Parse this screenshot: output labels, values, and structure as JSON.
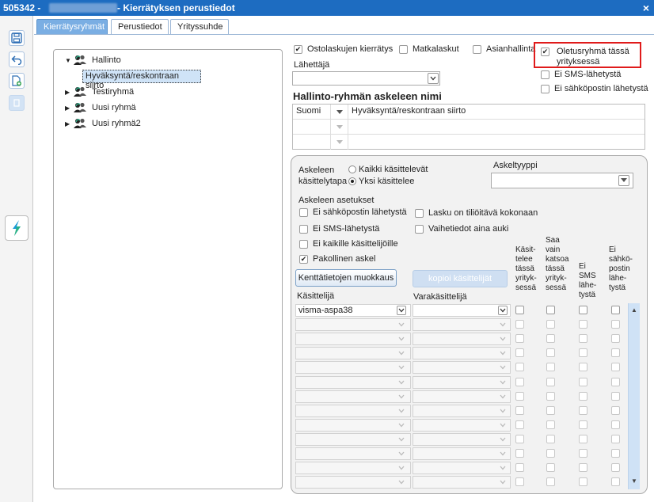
{
  "window": {
    "title_prefix": "505342 -",
    "title_suffix": "- Kierrätyksen perustiedot",
    "close_glyph": "×"
  },
  "toolbar": {
    "icons": [
      "save-icon",
      "back-icon",
      "new-document-icon",
      "disabled-action-icon",
      "app-logo-icon"
    ]
  },
  "tabs": [
    {
      "label": "Kierrätysryhmät",
      "active": true
    },
    {
      "label": "Perustiedot",
      "active": false
    },
    {
      "label": "Yrityssuhde",
      "active": false
    }
  ],
  "tree": {
    "nodes": [
      {
        "label": "Hallinto",
        "expanded": true
      },
      {
        "label": "Hyväksyntä/reskontraan siirto",
        "selected": true
      },
      {
        "label": "Testiryhmä",
        "expanded": false
      },
      {
        "label": "Uusi ryhmä",
        "expanded": false
      },
      {
        "label": "Uusi ryhmä2",
        "expanded": false
      }
    ]
  },
  "options": {
    "ostolaskujen": {
      "label": "Ostolaskujen kierrätys",
      "checked": true
    },
    "matkalaskut": {
      "label": "Matkalaskut",
      "checked": false
    },
    "asianhallinta": {
      "label": "Asianhallinta",
      "checked": false
    },
    "oletusryhma": {
      "label_line1": "Oletusryhmä tässä",
      "label_line2": "yrityksessä",
      "checked": true
    },
    "ei_sms": {
      "label": "Ei SMS-lähetystä",
      "checked": false
    },
    "ei_sahkoposti": {
      "label": "Ei sähköpostin lähetystä",
      "checked": false
    }
  },
  "sender": {
    "label": "Lähettäjä",
    "value": ""
  },
  "step_name": {
    "heading": "Hallinto-ryhmän askeleen nimi",
    "rows": [
      {
        "language": "Suomi",
        "name": "Hyväksyntä/reskontraan siirto"
      },
      {
        "language": "",
        "name": ""
      },
      {
        "language": "",
        "name": ""
      }
    ]
  },
  "step_panel": {
    "handling_label_line1": "Askeleen",
    "handling_label_line2": "käsittelytapa",
    "radio_all": {
      "label": "Kaikki käsittelevät",
      "selected": false
    },
    "radio_one": {
      "label": "Yksi käsittelee",
      "selected": true
    },
    "step_type_label": "Askeltyyppi",
    "step_type_value": "",
    "settings_heading": "Askeleen asetukset",
    "settings": {
      "ei_sahkoposti": {
        "label": "Ei sähköpostin lähetystä",
        "checked": false
      },
      "lasku_tiliointi": {
        "label": "Lasku on tiliöitävä kokonaan",
        "checked": false
      },
      "ei_sms": {
        "label": "Ei SMS-lähetystä",
        "checked": false
      },
      "vaihetiedot": {
        "label": "Vaihetiedot aina auki",
        "checked": false
      },
      "ei_kaikille": {
        "label": "Ei kaikille käsittelijöille",
        "checked": false
      },
      "pakollinen": {
        "label": "Pakollinen askel",
        "checked": true
      }
    },
    "edit_fields_button": "Kenttätietojen muokkaus",
    "copy_handlers_button": "kopioi käsittelijät",
    "columns": {
      "handler": "Käsittelijä",
      "backup": "Varakäsittelijä",
      "handles_here": "Käsit-\ntelee\ntässä\nyrityk-\nsessä",
      "view_only": "Saa\nvain\nkatsoa\ntässä\nyrityk-\nsessä",
      "no_sms": "Ei\nSMS\nlähe-\ntystä",
      "no_email": "Ei\nsähkö-\npostin\nlähe-\ntystä"
    },
    "handler_rows": [
      {
        "handler": "visma-aspa38",
        "backup": ""
      },
      {
        "handler": "",
        "backup": ""
      },
      {
        "handler": "",
        "backup": ""
      },
      {
        "handler": "",
        "backup": ""
      },
      {
        "handler": "",
        "backup": ""
      },
      {
        "handler": "",
        "backup": ""
      },
      {
        "handler": "",
        "backup": ""
      },
      {
        "handler": "",
        "backup": ""
      },
      {
        "handler": "",
        "backup": ""
      },
      {
        "handler": "",
        "backup": ""
      },
      {
        "handler": "",
        "backup": ""
      },
      {
        "handler": "",
        "backup": ""
      },
      {
        "handler": "",
        "backup": ""
      }
    ]
  },
  "colors": {
    "titlebar": "#1d6cc1",
    "active_tab": "#7aaee3",
    "highlight": "#e01b1b",
    "scrollbar": "#cfe2f6"
  }
}
